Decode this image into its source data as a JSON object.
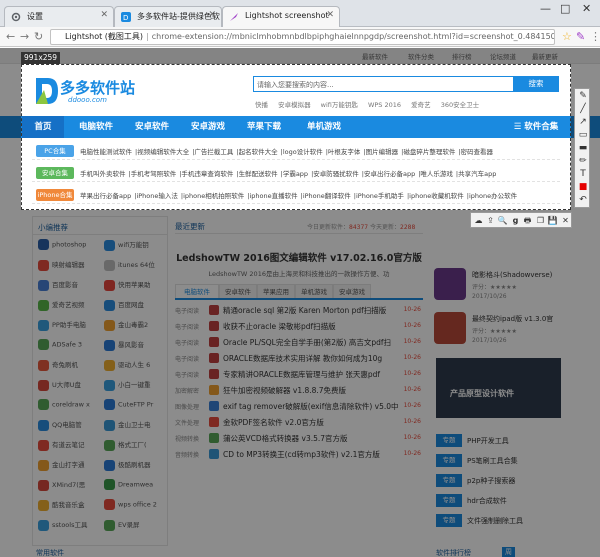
{
  "browser": {
    "tabs": [
      {
        "label": "设置",
        "color": "#5f6368"
      },
      {
        "label": "多多软件站-提供绿色软",
        "color": "#1a8ae0"
      },
      {
        "label": "Lightshot screenshot",
        "color": "#a040c8"
      }
    ],
    "window_controls": [
      "—",
      "□",
      "✕"
    ],
    "address": {
      "site": "Lightshot (截图工具)",
      "url": "chrome-extension://mbniclmhobmnbdlbpiphghaielnnpgdp/screenshot.html?id=screenshot_0.4841503..."
    }
  },
  "site": {
    "topstrip": [
      "最新软件",
      "软件分类",
      "排行榜",
      "论坛频道",
      "最新更新"
    ],
    "logo": {
      "title": "多多软件站",
      "subtitle": "ddooo.com"
    },
    "search": {
      "placeholder": "请输入您要搜索的内容...",
      "button": "搜索"
    },
    "hotwords": [
      "快播",
      "安卓模拟器",
      "wifi万能钥匙",
      "WPS 2016",
      "爱奇艺",
      "360安全卫士"
    ],
    "nav": [
      "首页",
      "电脑软件",
      "安卓软件",
      "安卓游戏",
      "苹果下载",
      "单机游戏",
      "☰ 软件合集"
    ],
    "categories": [
      {
        "label": "PC合集",
        "color": "#4aa3e8",
        "links": [
          "电脑性能测试软件",
          "视频编辑软件大全",
          "广告拦截工具",
          "起名软件大全",
          "logo设计软件",
          "叶根友字体",
          "图片编辑器",
          "磁盘碎片整理软件",
          "密码查看器"
        ]
      },
      {
        "label": "安卓合集",
        "color": "#5cb85c",
        "links": [
          "手机叫外卖软件",
          "手机考驾照软件",
          "手机违章查询软件",
          "生鲜配送软件",
          "学霸app",
          "安卓防骚扰软件",
          "安卓出行必备app",
          "唯人乐游戏",
          "共享汽车app"
        ]
      },
      {
        "label": "iPhone合集",
        "color": "#f0883a",
        "links": [
          "苹果出行必备app",
          "iPhone输入法",
          "iphone相机拍照软件",
          "iphone直播软件",
          "iPhone翻译软件",
          "iPhone手机助手",
          "iphone收藏机软件",
          "iphone办公软件"
        ]
      }
    ],
    "left": {
      "title": "小编推荐",
      "apps": [
        {
          "name": "photoshop",
          "color": "#2a5fa8"
        },
        {
          "name": "wifi万能钥",
          "color": "#2a8de0"
        },
        {
          "name": "映射编辑器",
          "color": "#e84c3d"
        },
        {
          "name": "itunes 64位",
          "color": "#c0c0c0"
        },
        {
          "name": "百度影音",
          "color": "#4a80d8"
        },
        {
          "name": "快用苹果助",
          "color": "#e8463d"
        },
        {
          "name": "爱奇艺视频",
          "color": "#59b94a"
        },
        {
          "name": "百度网盘",
          "color": "#2a8de0"
        },
        {
          "name": "PP助手电脑",
          "color": "#3aa0e0"
        },
        {
          "name": "金山毒霸2",
          "color": "#f0a030"
        },
        {
          "name": "ADSafe 3",
          "color": "#58a858"
        },
        {
          "name": "暴风影音",
          "color": "#2a7ad8"
        },
        {
          "name": "奇兔刷机",
          "color": "#e85a3d"
        },
        {
          "name": "驱动人生 6",
          "color": "#f0b030"
        },
        {
          "name": "U大师U盘",
          "color": "#d84a3d"
        },
        {
          "name": "小白一键重",
          "color": "#3aa0e0"
        },
        {
          "name": "coreldraw x",
          "color": "#58a858"
        },
        {
          "name": "CuteFTP Pr",
          "color": "#2a7ad8"
        },
        {
          "name": "QQ电脑管",
          "color": "#2a8de0"
        },
        {
          "name": "金山卫士电",
          "color": "#3a9ad8"
        },
        {
          "name": "有道云笔记",
          "color": "#e84c3d"
        },
        {
          "name": "格式工厂(",
          "color": "#58a858"
        },
        {
          "name": "金山打字通",
          "color": "#f0a030"
        },
        {
          "name": "极酷刷机器",
          "color": "#2a7ad8"
        },
        {
          "name": "XMind7(思",
          "color": "#d84a3d"
        },
        {
          "name": "Dreamwea",
          "color": "#3a9a4a"
        },
        {
          "name": "酷我音乐盒",
          "color": "#f0b030"
        },
        {
          "name": "wps office 2",
          "color": "#e84c3d"
        },
        {
          "name": "sstools工具",
          "color": "#3aa0e0"
        },
        {
          "name": "EV录屏",
          "color": "#58a858"
        }
      ]
    },
    "middle": {
      "title": "最近更新",
      "stats": {
        "label_today": "今日更新软件：",
        "today": "84377",
        "label_total": " 今天更新：",
        "total": "2288"
      },
      "feature_title": "LedshowTW 2016图文编辑软件 v17.02.16.0官方版",
      "feature_sub": "LedshowTW 2016是由上海灵和科技推出的一款操作方便、功",
      "tabs": [
        "电脑软件",
        "安卓软件",
        "苹果应用",
        "单机游戏",
        "安卓游戏"
      ],
      "rows": [
        {
          "cat": "电子阅读",
          "title": "精通oracle sql 第2版 Karen Morton pdf扫描版",
          "date": "10-26",
          "color": "#c04040"
        },
        {
          "cat": "电子阅读",
          "title": "收获不止oracle 梁敬彬pdf扫描版",
          "date": "10-26",
          "color": "#c04040"
        },
        {
          "cat": "电子阅读",
          "title": "Oracle PL/SQL完全自学手册(第2版) 高吉文pdf扫",
          "date": "10-26",
          "color": "#c04040"
        },
        {
          "cat": "电子阅读",
          "title": "ORACLE数据库技术实用详解 教你如何成为10g",
          "date": "10-26",
          "color": "#c04040"
        },
        {
          "cat": "电子阅读",
          "title": "专家精讲ORACLE数据库管理与维护 张天惠pdf",
          "date": "10-26",
          "color": "#c04040"
        },
        {
          "cat": "加密解密",
          "title": "狂牛加密视频破解器 v1.8.8.7免费版",
          "date": "10-26",
          "color": "#f0a030"
        },
        {
          "cat": "图像处理",
          "title": "exif tag remover破解版(exif信息清除软件) v5.0中",
          "date": "10-26",
          "color": "#3a80d8"
        },
        {
          "cat": "文件处理",
          "title": "金软PDF签名软件 v2.0官方版",
          "date": "10-26",
          "color": "#e84c3d"
        },
        {
          "cat": "视频转换",
          "title": "蒲公英VCD格式转换器 v3.5.7官方版",
          "date": "10-26",
          "color": "#58a858"
        },
        {
          "cat": "音频转换",
          "title": "CD to MP3转换王(cd转mp3软件) v2.1官方版",
          "date": "10-26",
          "color": "#3a9ad8"
        }
      ]
    },
    "right": {
      "games": [
        {
          "name": "暗影格斗(Shadowverse)",
          "score": "评分：★★★★★",
          "date": "2017/10/26",
          "color": "#6a3a8a"
        },
        {
          "name": "最终契约ipad版 v1.3.0官",
          "score": "评分：★★★★★",
          "date": "2017/10/26",
          "color": "#b84a3a"
        }
      ],
      "banner": "产品原型设计软件",
      "topics": [
        {
          "badge": "专题",
          "title": "PHP开发工具"
        },
        {
          "badge": "专题",
          "title": "PS笔刷工具合集"
        },
        {
          "badge": "专题",
          "title": "p2p种子搜索器"
        },
        {
          "badge": "专题",
          "title": "hdr合成软件"
        },
        {
          "badge": "专题",
          "title": "文件强制删除工具"
        }
      ]
    },
    "bottom": {
      "common_title": "常用软件",
      "rank_title": "软件排行榜",
      "rank_tab": "周"
    }
  },
  "lightshot": {
    "dimensions": "991x259",
    "vertical_tools": [
      "✎",
      "╱",
      "↗",
      "▭",
      "▬",
      "✏",
      "T",
      "■",
      "↶"
    ],
    "horizontal_tools": [
      "☁",
      "⇪",
      "🔍",
      "g",
      "🖶",
      "❐",
      "💾",
      "✕"
    ],
    "accent_color": "#e50000"
  }
}
